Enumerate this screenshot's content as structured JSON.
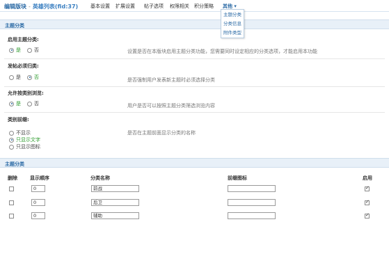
{
  "header": {
    "title": "编辑版块",
    "forum": "英雄列表(fid:37)",
    "nav": [
      "基本设置",
      "扩展设置",
      "帖子选项",
      "权限相关",
      "积分策略"
    ],
    "more_label": "其他 ▾",
    "dropdown": [
      "主题分类",
      "分类信息",
      "附件类型"
    ]
  },
  "section1": {
    "title": "主题分类",
    "settings": [
      {
        "label": "启用主题分类:",
        "options": [
          "是",
          "否"
        ],
        "selected": 0,
        "desc": "设置是否在本版块启用主题分类功能，您需要同时设定相应的分类选项，才能启用本功能"
      },
      {
        "label": "发帖必须归类:",
        "options": [
          "是",
          "否"
        ],
        "selected": 1,
        "desc": "是否强制用户发表新主题时必须选择分类"
      },
      {
        "label": "允许按类别浏览:",
        "options": [
          "是",
          "否"
        ],
        "selected": 0,
        "desc": "用户是否可以按照主题分类筛选浏览内容"
      },
      {
        "label": "类别前缀:",
        "options": [
          "不显示",
          "只显示文字",
          "只显示图标"
        ],
        "selected": 1,
        "desc": "是否在主题前面显示分类的名称"
      }
    ]
  },
  "section2": {
    "title": "主题分类",
    "columns": [
      "删除",
      "显示顺序",
      "分类名称",
      "前缀图标",
      "启用"
    ],
    "rows": [
      {
        "order": "0",
        "name": "前战"
      },
      {
        "order": "0",
        "name": "后卫"
      },
      {
        "order": "0",
        "name": "辅助"
      }
    ]
  }
}
